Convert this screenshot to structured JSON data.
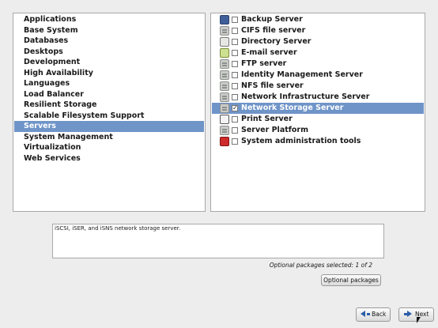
{
  "groups": [
    {
      "label": "Applications"
    },
    {
      "label": "Base System"
    },
    {
      "label": "Databases"
    },
    {
      "label": "Desktops"
    },
    {
      "label": "Development"
    },
    {
      "label": "High Availability"
    },
    {
      "label": "Languages"
    },
    {
      "label": "Load Balancer"
    },
    {
      "label": "Resilient Storage"
    },
    {
      "label": "Scalable Filesystem Support"
    },
    {
      "label": "Servers",
      "selected": true
    },
    {
      "label": "System Management"
    },
    {
      "label": "Virtualization"
    },
    {
      "label": "Web Services"
    }
  ],
  "packages": [
    {
      "label": "Backup Server",
      "icon": "monitor-icon",
      "checked": false
    },
    {
      "label": "CIFS file server",
      "icon": "server-icon",
      "checked": false
    },
    {
      "label": "Directory Server",
      "icon": "directory-icon",
      "checked": false
    },
    {
      "label": "E-mail server",
      "icon": "mail-icon",
      "checked": false
    },
    {
      "label": "FTP server",
      "icon": "server-icon",
      "checked": false
    },
    {
      "label": "Identity Management Server",
      "icon": "server-icon",
      "checked": false
    },
    {
      "label": "NFS file server",
      "icon": "server-icon",
      "checked": false
    },
    {
      "label": "Network Infrastructure Server",
      "icon": "server-icon",
      "checked": false
    },
    {
      "label": "Network Storage Server",
      "icon": "server-icon",
      "checked": true,
      "selected": true
    },
    {
      "label": "Print Server",
      "icon": "printer-icon",
      "checked": false
    },
    {
      "label": "Server Platform",
      "icon": "server-icon",
      "checked": false
    },
    {
      "label": "System administration tools",
      "icon": "tools-icon",
      "checked": false
    }
  ],
  "description": "iSCSI, iSER, and iSNS network storage server.",
  "optional_status": "Optional packages selected: 1 of 2",
  "buttons": {
    "optional_packages": "Optional packages",
    "back": "Back",
    "next": "Next"
  },
  "colors": {
    "selection": "#6f94c8",
    "window_bg": "#ededed"
  }
}
